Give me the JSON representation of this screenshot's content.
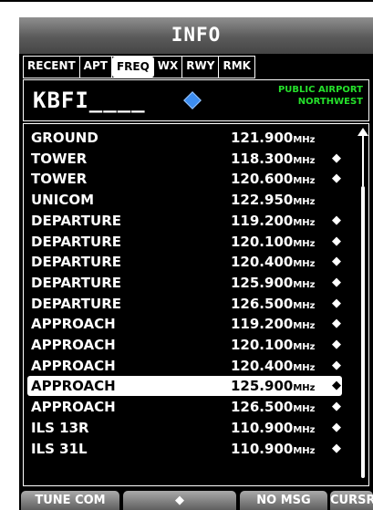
{
  "title": "INFO",
  "tabs": [
    {
      "label": "RECENT"
    },
    {
      "label": "APT"
    },
    {
      "label": "FREQ"
    },
    {
      "label": "WX"
    },
    {
      "label": "RWY"
    },
    {
      "label": "RMK"
    }
  ],
  "active_tab": "FREQ",
  "airport": {
    "ident": "KBFI____",
    "type_line1": "PUBLIC AIRPORT",
    "type_line2": "NORTHWEST",
    "icon": "diamond-waypoint-icon",
    "icon_color": "#3d8df0"
  },
  "unit": "MHz",
  "frequencies": [
    {
      "name": "GROUND",
      "freq": "121.900",
      "mark": ""
    },
    {
      "name": "TOWER",
      "freq": "118.300",
      "mark": "◆"
    },
    {
      "name": "TOWER",
      "freq": "120.600",
      "mark": "◆"
    },
    {
      "name": "UNICOM",
      "freq": "122.950",
      "mark": ""
    },
    {
      "name": "DEPARTURE",
      "freq": "119.200",
      "mark": "◆"
    },
    {
      "name": "DEPARTURE",
      "freq": "120.100",
      "mark": "◆"
    },
    {
      "name": "DEPARTURE",
      "freq": "120.400",
      "mark": "◆"
    },
    {
      "name": "DEPARTURE",
      "freq": "125.900",
      "mark": "◆"
    },
    {
      "name": "DEPARTURE",
      "freq": "126.500",
      "mark": "◆"
    },
    {
      "name": "APPROACH",
      "freq": "119.200",
      "mark": "◆"
    },
    {
      "name": "APPROACH",
      "freq": "120.100",
      "mark": "◆"
    },
    {
      "name": "APPROACH",
      "freq": "120.400",
      "mark": "◆"
    },
    {
      "name": "APPROACH",
      "freq": "125.900",
      "mark": "◆"
    },
    {
      "name": "APPROACH",
      "freq": "126.500",
      "mark": "◆"
    },
    {
      "name": "ILS 13R",
      "freq": "110.900",
      "mark": "◆"
    },
    {
      "name": "ILS 31L",
      "freq": "110.900",
      "mark": "◆"
    }
  ],
  "selected_index": 12,
  "softkeys": [
    {
      "label": "TUNE COM"
    },
    {
      "label": "◆"
    },
    {
      "label": "NO MSG"
    },
    {
      "label": "CURSR"
    }
  ],
  "colors": {
    "background": "#000000",
    "text": "#ffffff",
    "airport_type": "#25e02b"
  }
}
